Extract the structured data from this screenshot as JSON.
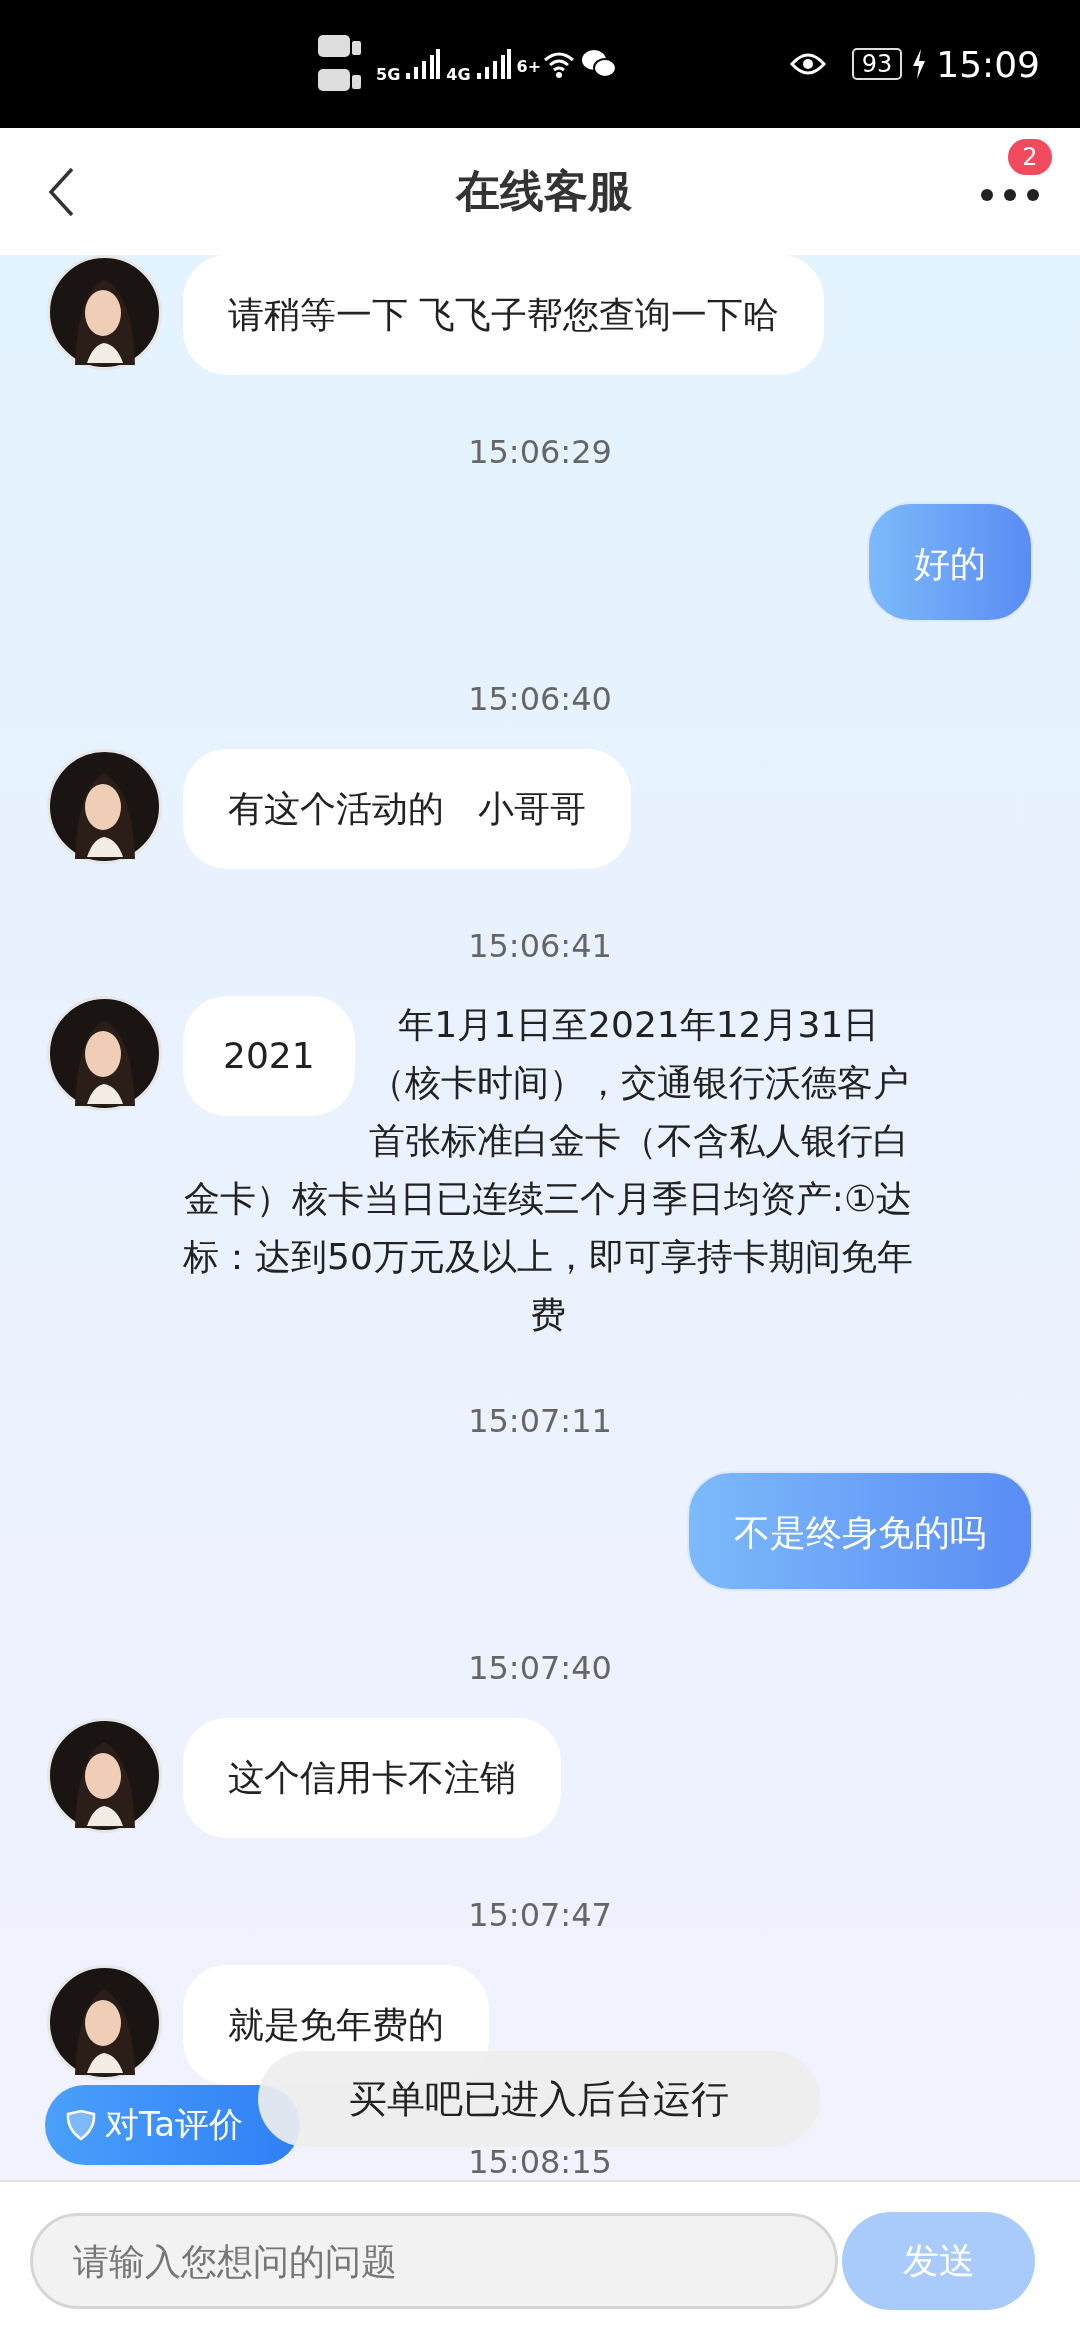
{
  "status_bar": {
    "network_1": "5G",
    "network_2": "4G",
    "wifi_label": "6+",
    "battery": "93",
    "time": "15:09"
  },
  "header": {
    "title": "在线客服",
    "badge": "2"
  },
  "messages": [
    {
      "kind": "agent",
      "text": "请稍等一下 飞飞子帮您查询一下哈"
    },
    {
      "kind": "time",
      "text": "15:06:29"
    },
    {
      "kind": "user",
      "text": "好的"
    },
    {
      "kind": "time",
      "text": "15:06:40"
    },
    {
      "kind": "agent",
      "text": "有这个活动的   小哥哥"
    },
    {
      "kind": "time",
      "text": "15:06:41"
    },
    {
      "kind": "agent_overflow",
      "text": "2021",
      "overflow": "年1月1日至2021年12月31日（核卡时间），交通银行沃德客户首张标准白金卡（不含私人银行白金卡）核卡当日已连续三个月季日均资产:①达标：达到50万元及以上，即可享持卡期间免年费"
    },
    {
      "kind": "time",
      "text": "15:07:11"
    },
    {
      "kind": "user",
      "text": "不是终身免的吗"
    },
    {
      "kind": "time",
      "text": "15:07:40"
    },
    {
      "kind": "agent",
      "text": "这个信用卡不注销"
    },
    {
      "kind": "time",
      "text": "15:07:47"
    },
    {
      "kind": "agent",
      "text": "就是免年费的"
    },
    {
      "kind": "time",
      "text": "15:08:15"
    }
  ],
  "rate_button": "对Ta评价",
  "toast": "买单吧已进入后台运行",
  "input": {
    "placeholder": "请输入您想问的问题"
  },
  "send_button": "发送"
}
